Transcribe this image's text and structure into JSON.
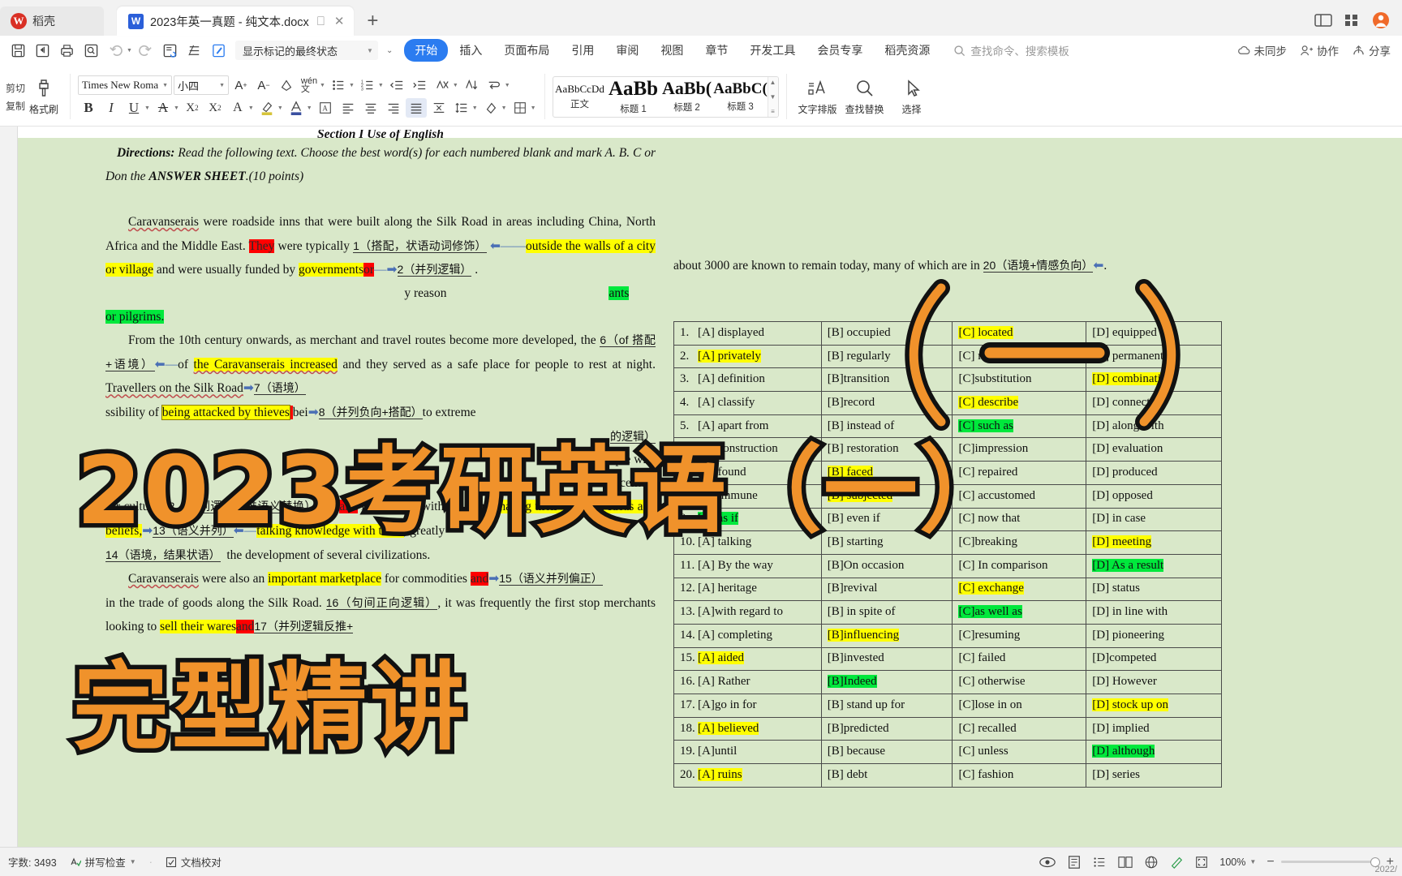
{
  "titlebar": {
    "home_label": "稻壳",
    "tab_title": "2023年英一真题 - 纯文本.docx",
    "logo_glyph": "W",
    "doc_glyph": "W",
    "new_tab": "+"
  },
  "ribbon": {
    "markup_state": "显示标记的最终状态",
    "tabs": [
      {
        "label": "开始",
        "active": true
      },
      {
        "label": "插入",
        "active": false
      },
      {
        "label": "页面布局",
        "active": false
      },
      {
        "label": "引用",
        "active": false
      },
      {
        "label": "审阅",
        "active": false
      },
      {
        "label": "视图",
        "active": false
      },
      {
        "label": "章节",
        "active": false
      },
      {
        "label": "开发工具",
        "active": false
      },
      {
        "label": "会员专享",
        "active": false
      },
      {
        "label": "稻壳资源",
        "active": false
      }
    ],
    "search_placeholder": "查找命令、搜索模板",
    "right_items": [
      {
        "label": "未同步",
        "icon": "cloud-sync-icon"
      },
      {
        "label": "协作",
        "icon": "collaborate-icon"
      },
      {
        "label": "分享",
        "icon": "share-icon"
      }
    ]
  },
  "home_tab": {
    "cut_label": "剪切",
    "copy_label": "复制",
    "format_painter_label": "格式刷",
    "font_name": "Times New Roma",
    "font_size": "小四",
    "styles": [
      {
        "preview": "AaBbCcDd",
        "name": "正文",
        "size": "13px"
      },
      {
        "preview": "AaBb",
        "name": "标题 1",
        "size": "25px"
      },
      {
        "preview": "AaBb(",
        "name": "标题 2",
        "size": "22px"
      },
      {
        "preview": "AaBbC(",
        "name": "标题 3",
        "size": "19px"
      }
    ],
    "typography_label": "文字排版",
    "find_replace_label": "查找替换",
    "select_label": "选择"
  },
  "document": {
    "section_title": "Section I  Use of English",
    "directions_label": "Directions:",
    "directions_text": " Read the following text. Choose the best word(s) for each numbered blank and mark A. B. C or Don the ",
    "answer_sheet": "ANSWER SHEET",
    "points": ".(10 points)",
    "top_right_line": "about 3000 are known to remain today, many of which are in ",
    "top_right_blank": "20（语境+情感负向）",
    "p1_a": "Caravanserais",
    "p1_b": " were roadside inns that were built along the Silk Road in areas including China, North Africa and the Middle East. ",
    "p1_they": "They",
    "p1_c": " were typically ",
    "blank1": "1（搭配，状语动词修饰）",
    "p1_d": "outside the walls of a city or village",
    "p1_e": " and were usually funded by ",
    "p1_gov": "governments",
    "p1_or": "or",
    "blank2": "2（并列逻辑）",
    "p2_pilgrims": "or pilgrims.",
    "p2_frag_reason": "y reason",
    "p2_frag_ants": "ants",
    "p3_a": "From the 10th century onwards, as merchant and travel routes become more developed, the ",
    "blank6": "6（of 搭配+语境）",
    "p3_of": "of ",
    "p3_b": "the Caravanserais increased",
    "p3_c": " and they served as a safe place for people to rest at night. ",
    "p3_d": "Travellers on the Silk Road",
    "blank7": "7（语境）",
    "p3_e": "ssibility of ",
    "p3_f": "being attacked by thieves",
    "p3_g": "bei",
    "blank8": "8（并列负向+搭配）",
    "p3_h": "to extreme",
    "blank9_hint": "的逻辑）",
    "p4_people": "people who",
    "p4_centers": "important centers",
    "p5_a": "for culture ",
    "blank12": "12（并列逻辑反推语义替换）",
    "p5_and": "and",
    "p5_b": " interaction, with travelers ",
    "p5_c": "sharing their cultures, ideas and beliefs,",
    "blank13": "13（语义并列）",
    "p5_d": "talking knowledge with them",
    "p5_e": ", greatly",
    "blank14": "14（语境，结果状语）",
    "p5_f": "the development of several civilizations.",
    "p6_a": "Caravanserais",
    "p6_b": " were also an ",
    "p6_c": "important marketplace",
    "p6_d": " for commodities ",
    "p6_and": "and",
    "blank15": "15（语义并列偏正）",
    "p6_e": "in the trade of goods along the Silk Road. ",
    "blank16": "16（句间正向逻辑）",
    "p6_f": ", it was frequently the first stop merchants looking to ",
    "p6_g": "sell their wares",
    "p6_and2": "and",
    "blank17": "17（并列逻辑反推+"
  },
  "answers": {
    "rows": [
      {
        "n": "1.",
        "a": "[A] displayed",
        "b": "[B] occupied",
        "c": "[C] located",
        "d": "[D] equipped",
        "ha": "none",
        "hb": "none",
        "hc": "yellow",
        "hd": "none"
      },
      {
        "n": "2.",
        "a": "[A] privately",
        "b": "[B] regularly",
        "c": "[C] respectively",
        "d": "[D] permanently",
        "ha": "yellow",
        "hb": "none",
        "hc": "none",
        "hd": "none"
      },
      {
        "n": "3.",
        "a": "[A] definition",
        "b": "[B]transition",
        "c": "[C]substitution",
        "d": "[D] combination",
        "ha": "none",
        "hb": "none",
        "hc": "none",
        "hd": "yellow"
      },
      {
        "n": "4.",
        "a": "[A] classify",
        "b": "[B]record",
        "c": "[C] describe",
        "d": "[D] connect",
        "ha": "none",
        "hb": "none",
        "hc": "yellow",
        "hd": "none"
      },
      {
        "n": "5.",
        "a": "[A] apart from",
        "b": "[B] instead of",
        "c": "[C] such as",
        "d": "[D] along with",
        "ha": "none",
        "hb": "none",
        "hc": "green",
        "hd": "none"
      },
      {
        "n": "6.",
        "a": "[A] construction",
        "b": "[B] restoration",
        "c": "[C]impression",
        "d": "[D] evaluation",
        "ha": "none",
        "hb": "none",
        "hc": "none",
        "hd": "none"
      },
      {
        "n": "7.",
        "a": "[A] found",
        "b": "[B] faced",
        "c": "[C] repaired",
        "d": "[D] produced",
        "ha": "none",
        "hb": "yellow",
        "hc": "none",
        "hd": "none"
      },
      {
        "n": "8.",
        "a": "[A] immune",
        "b": "[B] subjected",
        "c": "[C] accustomed",
        "d": "[D] opposed",
        "ha": "none",
        "hb": "yellow",
        "hc": "none",
        "hd": "none"
      },
      {
        "n": "9.",
        "a": "[A] as if",
        "b": "[B] even if",
        "c": "[C] now that",
        "d": "[D] in case",
        "ha": "green",
        "hb": "none",
        "hc": "none",
        "hd": "none"
      },
      {
        "n": "10.",
        "a": "[A] talking",
        "b": "[B] starting",
        "c": "[C]breaking",
        "d": "[D] meeting",
        "ha": "none",
        "hb": "none",
        "hc": "none",
        "hd": "yellow"
      },
      {
        "n": "11.",
        "a": "[A] By the way",
        "b": "[B]On occasion",
        "c": "[C] In comparison",
        "d": "[D] As a result",
        "ha": "none",
        "hb": "none",
        "hc": "none",
        "hd": "green"
      },
      {
        "n": "12.",
        "a": "[A] heritage",
        "b": "[B]revival",
        "c": "[C] exchange",
        "d": "[D] status",
        "ha": "none",
        "hb": "none",
        "hc": "yellow",
        "hd": "none"
      },
      {
        "n": "13.",
        "a": "[A]with regard to",
        "b": "[B] in spite of",
        "c": "[C]as well as",
        "d": "[D] in line with",
        "ha": "none",
        "hb": "none",
        "hc": "green",
        "hd": "none"
      },
      {
        "n": "14.",
        "a": "[A] completing",
        "b": "[B]influencing",
        "c": "[C]resuming",
        "d": "[D] pioneering",
        "ha": "none",
        "hb": "yellow",
        "hc": "none",
        "hd": "none"
      },
      {
        "n": "15.",
        "a": "[A] aided",
        "b": "[B]invested",
        "c": "[C] failed",
        "d": "[D]competed",
        "ha": "yellow",
        "hb": "none",
        "hc": "none",
        "hd": "none"
      },
      {
        "n": "16.",
        "a": "[A] Rather",
        "b": "[B]Indeed",
        "c": "[C] otherwise",
        "d": "[D] However",
        "ha": "none",
        "hb": "green",
        "hc": "none",
        "hd": "none"
      },
      {
        "n": "17.",
        "a": "[A]go in for",
        "b": "[B] stand up for",
        "c": "[C]lose in on",
        "d": "[D] stock up on",
        "ha": "none",
        "hb": "none",
        "hc": "none",
        "hd": "yellow"
      },
      {
        "n": "18.",
        "a": "[A] believed",
        "b": "[B]predicted",
        "c": "[C] recalled",
        "d": "[D] implied",
        "ha": "yellow",
        "hb": "none",
        "hc": "none",
        "hd": "none"
      },
      {
        "n": "19.",
        "a": "[A]until",
        "b": "[B] because",
        "c": "[C] unless",
        "d": "[D] although",
        "ha": "none",
        "hb": "none",
        "hc": "none",
        "hd": "green"
      },
      {
        "n": "20.",
        "a": "[A] ruins",
        "b": "[B] debt",
        "c": "[C] fashion",
        "d": "[D] series",
        "ha": "yellow",
        "hb": "none",
        "hc": "none",
        "hd": "none"
      }
    ]
  },
  "overlay": {
    "line1": "2023考研英语（一）",
    "line2": "完型精讲",
    "color": "#F0922B",
    "stroke": "#111111"
  },
  "status": {
    "word_count": "字数: 3493",
    "spellcheck": "拼写检查",
    "proofread": "文档校对",
    "zoom": "100%",
    "zoom_out": "−",
    "zoom_in": "+",
    "corner": "2022/"
  }
}
